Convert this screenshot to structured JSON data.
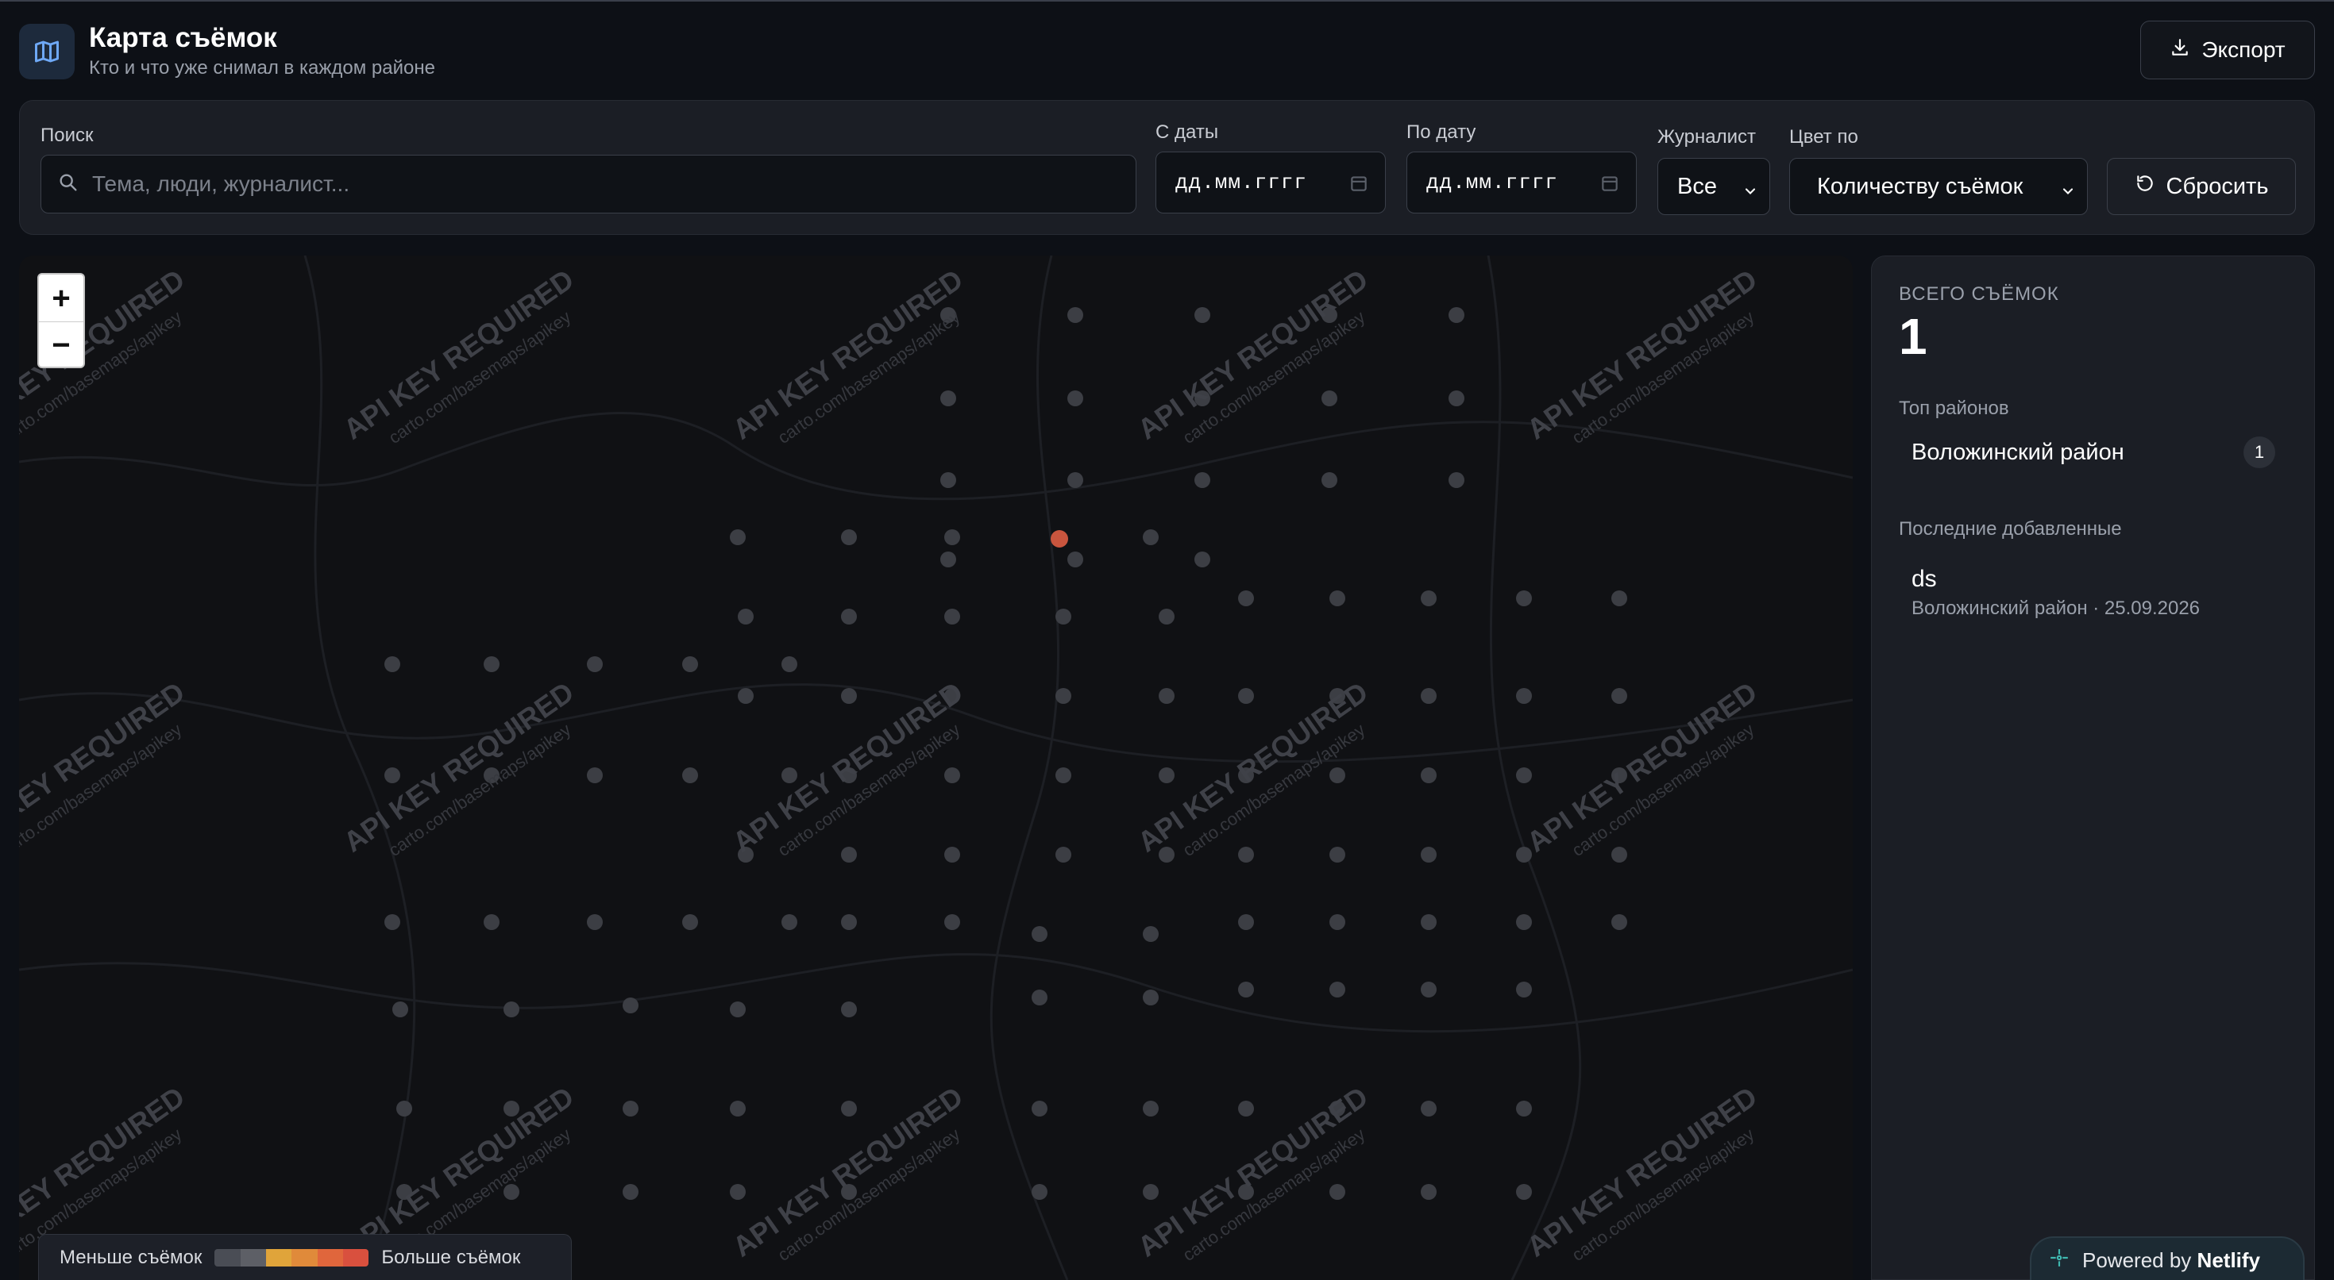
{
  "header": {
    "title": "Карта съёмок",
    "subtitle": "Кто и что уже снимал в каждом районе",
    "export_label": "Экспорт"
  },
  "filters": {
    "search_label": "Поиск",
    "search_placeholder": "Тема, люди, журналист...",
    "date_from_label": "С даты",
    "date_from_value": "дд.мм.гггг",
    "date_to_label": "По дату",
    "date_to_value": "дд.мм.гггг",
    "journalist_label": "Журналист",
    "journalist_value": "Все",
    "color_by_label": "Цвет по",
    "color_by_value": "Количеству съёмок",
    "reset_label": "Сбросить"
  },
  "map": {
    "zoom_in": "+",
    "zoom_out": "−",
    "watermark_main": "API KEY REQUIRED",
    "watermark_sub": "carto.com/basemaps/apikey",
    "legend_less": "Меньше съёмок",
    "legend_more": "Больше съёмок",
    "legend_colors": [
      "#4a4d55",
      "#5d5f66",
      "#e0a43a",
      "#e08a3a",
      "#e0663c",
      "#d9503e"
    ],
    "dot_color": "#3c3e44",
    "active_dot_color": "#c9553e"
  },
  "panel": {
    "total_label": "ВСЕГО СЪЁМОК",
    "total_value": "1",
    "top_label": "Топ районов",
    "top_items": [
      {
        "name": "Воложинский район",
        "count": "1"
      }
    ],
    "recent_label": "Последние добавленные",
    "recent_items": [
      {
        "title": "ds",
        "meta": "Воложинский район · 25.09.2026"
      }
    ]
  },
  "footer": {
    "powered_by": "Powered by",
    "brand": "Netlify"
  }
}
